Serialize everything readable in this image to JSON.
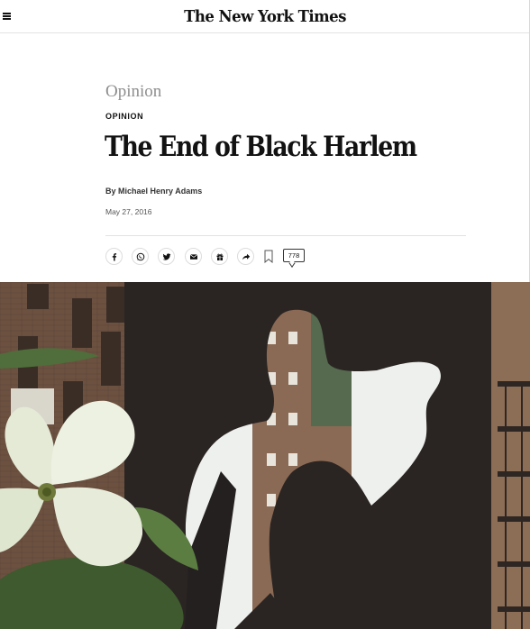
{
  "header": {
    "masthead": "The New York Times",
    "menu_icon": "hamburger-menu-icon"
  },
  "article": {
    "section": "Opinion",
    "kicker": "OPINION",
    "headline": "The End of Black Harlem",
    "byline": "By Michael Henry Adams",
    "date": "May 27, 2016"
  },
  "share_tools": {
    "buttons": [
      {
        "icon": "facebook-icon"
      },
      {
        "icon": "whatsapp-icon"
      },
      {
        "icon": "twitter-icon"
      },
      {
        "icon": "email-icon"
      },
      {
        "icon": "gift-icon"
      },
      {
        "icon": "share-arrow-icon"
      }
    ],
    "bookmark_icon": "bookmark-icon",
    "comment_count": "778"
  },
  "hero_image": {
    "subject": "silhouette sculpture in front of Harlem apartment buildings with dogwood flower"
  }
}
